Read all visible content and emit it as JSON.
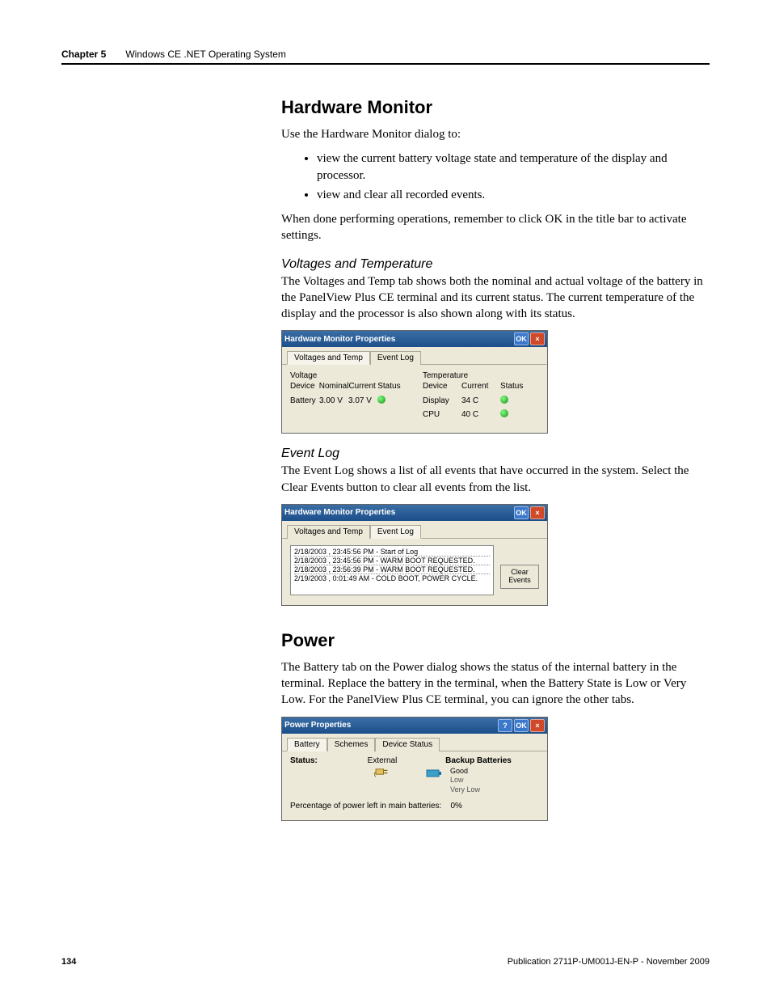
{
  "header": {
    "chapter": "Chapter 5",
    "title": "Windows CE .NET Operating System"
  },
  "section1": {
    "heading": "Hardware Monitor",
    "intro": "Use the Hardware Monitor dialog to:",
    "bullets": [
      "view the current battery voltage state and temperature of the display and processor.",
      "view and clear all recorded events."
    ],
    "after": "When done performing operations, remember to click OK in the title bar to activate settings."
  },
  "sub_vt": {
    "heading": "Voltages and Temperature",
    "body": "The Voltages and Temp tab shows both the nominal and actual voltage of the battery in the PanelView Plus CE terminal and its current status. The current temperature of the display and the processor is also shown along with its status."
  },
  "dlg_vt": {
    "title": "Hardware Monitor Properties",
    "ok": "OK",
    "close": "×",
    "tabs": {
      "t1": "Voltages and Temp",
      "t2": "Event Log"
    },
    "voltage": {
      "group": "Voltage",
      "h1": "Device",
      "h2": "Nominal",
      "h3": "Current",
      "h4": "Status",
      "row": {
        "device": "Battery",
        "nominal": "3.00 V",
        "current": "3.07 V"
      }
    },
    "temp": {
      "group": "Temperature",
      "h1": "Device",
      "h2": "Current",
      "h3": "Status",
      "row1": {
        "device": "Display",
        "current": "34 C"
      },
      "row2": {
        "device": "CPU",
        "current": "40 C"
      }
    }
  },
  "sub_el": {
    "heading": "Event Log",
    "body": "The Event Log shows a list of all events that have occurred in the system. Select the Clear Events button to clear all events from the list."
  },
  "dlg_el": {
    "title": "Hardware Monitor Properties",
    "ok": "OK",
    "close": "×",
    "tabs": {
      "t1": "Voltages and Temp",
      "t2": "Event Log"
    },
    "events": [
      "2/18/2003 , 23:45:56 PM - Start of Log",
      "2/18/2003 , 23:45:56 PM - WARM BOOT REQUESTED.",
      "2/18/2003 , 23:56:39 PM - WARM BOOT REQUESTED.",
      "2/19/2003 , 0:01:49 AM - COLD BOOT, POWER CYCLE."
    ],
    "clear": "Clear Events"
  },
  "section2": {
    "heading": "Power",
    "body": "The Battery tab on the Power dialog shows the status of the internal battery in the terminal. Replace the battery in the terminal, when the Battery State is Low or Very Low. For the PanelView Plus CE terminal, you can ignore the other tabs."
  },
  "dlg_pw": {
    "title": "Power Properties",
    "help": "?",
    "ok": "OK",
    "close": "×",
    "tabs": {
      "t1": "Battery",
      "t2": "Schemes",
      "t3": "Device Status"
    },
    "status_label": "Status:",
    "external": "External",
    "backup_title": "Backup Batteries",
    "states": {
      "good": "Good",
      "low": "Low",
      "vlow": "Very Low"
    },
    "pct_label": "Percentage of power left in main batteries:",
    "pct_value": "0%"
  },
  "footer": {
    "page": "134",
    "pub": "Publication 2711P-UM001J-EN-P - November 2009"
  }
}
